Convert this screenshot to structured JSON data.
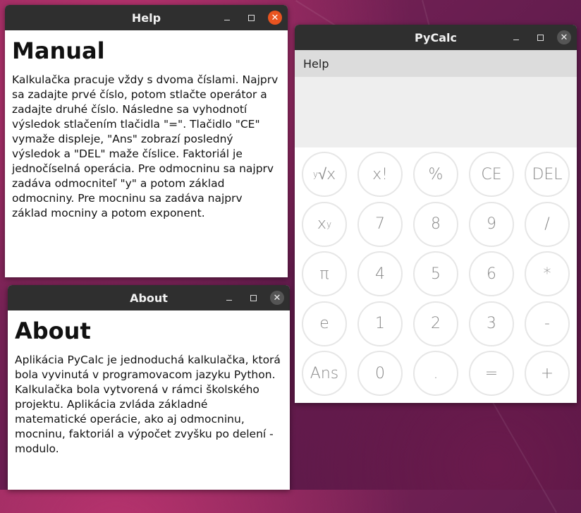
{
  "help_window": {
    "title": "Help",
    "heading": "Manual",
    "text": "Kalkulačka pracuje vždy s dvoma číslami. Najprv sa zadajte prvé číslo, potom stlačte operátor a zadajte druhé číslo. Následne sa vyhodnotí výsledok stlačením tlačidla \"=\". Tlačidlo \"CE\" vymaže displeje, \"Ans\" zobrazí posledný výsledok a \"DEL\" maže číslice. Faktoriál je jednočíselná operácia. Pre odmocninu sa najprv zadáva odmocniteľ \"y\" a potom základ odmocniny. Pre mocninu sa zadáva najprv základ mocniny a potom exponent.",
    "close": "✕"
  },
  "about_window": {
    "title": "About",
    "heading": "About",
    "text": "Aplikácia PyCalc je jednoduchá kalkulačka, ktorá bola vyvinutá v programovacom jazyku Python. Kalkulačka bola vytvorená v rámci školského projektu. Aplikácia zvláda základné matematické operácie, ako aj odmocninu, mocninu, faktoriál a výpočet zvyšku po delení - modulo.",
    "close": "✕"
  },
  "calc_window": {
    "title": "PyCalc",
    "menu": "Help",
    "close": "✕",
    "keys": [
      {
        "label": "√x",
        "sup": "y",
        "name": "root-key"
      },
      {
        "label": "x!",
        "name": "factorial-key"
      },
      {
        "label": "%",
        "name": "modulo-key"
      },
      {
        "label": "CE",
        "name": "clear-key"
      },
      {
        "label": "DEL",
        "name": "delete-key"
      },
      {
        "label": "x",
        "sup": "y",
        "name": "power-key"
      },
      {
        "label": "7",
        "name": "digit-7-key"
      },
      {
        "label": "8",
        "name": "digit-8-key"
      },
      {
        "label": "9",
        "name": "digit-9-key"
      },
      {
        "label": "/",
        "name": "divide-key"
      },
      {
        "label": "π",
        "name": "pi-key"
      },
      {
        "label": "4",
        "name": "digit-4-key"
      },
      {
        "label": "5",
        "name": "digit-5-key"
      },
      {
        "label": "6",
        "name": "digit-6-key"
      },
      {
        "label": "*",
        "name": "multiply-key"
      },
      {
        "label": "e",
        "name": "euler-key"
      },
      {
        "label": "1",
        "name": "digit-1-key"
      },
      {
        "label": "2",
        "name": "digit-2-key"
      },
      {
        "label": "3",
        "name": "digit-3-key"
      },
      {
        "label": "-",
        "name": "subtract-key"
      },
      {
        "label": "Ans",
        "name": "ans-key"
      },
      {
        "label": "0",
        "name": "digit-0-key"
      },
      {
        "label": ".",
        "name": "decimal-key"
      },
      {
        "label": "=",
        "name": "equals-key"
      },
      {
        "label": "+",
        "name": "add-key"
      }
    ]
  },
  "colors": {
    "accent": "#e95420",
    "titlebar": "#2f2f2f"
  }
}
